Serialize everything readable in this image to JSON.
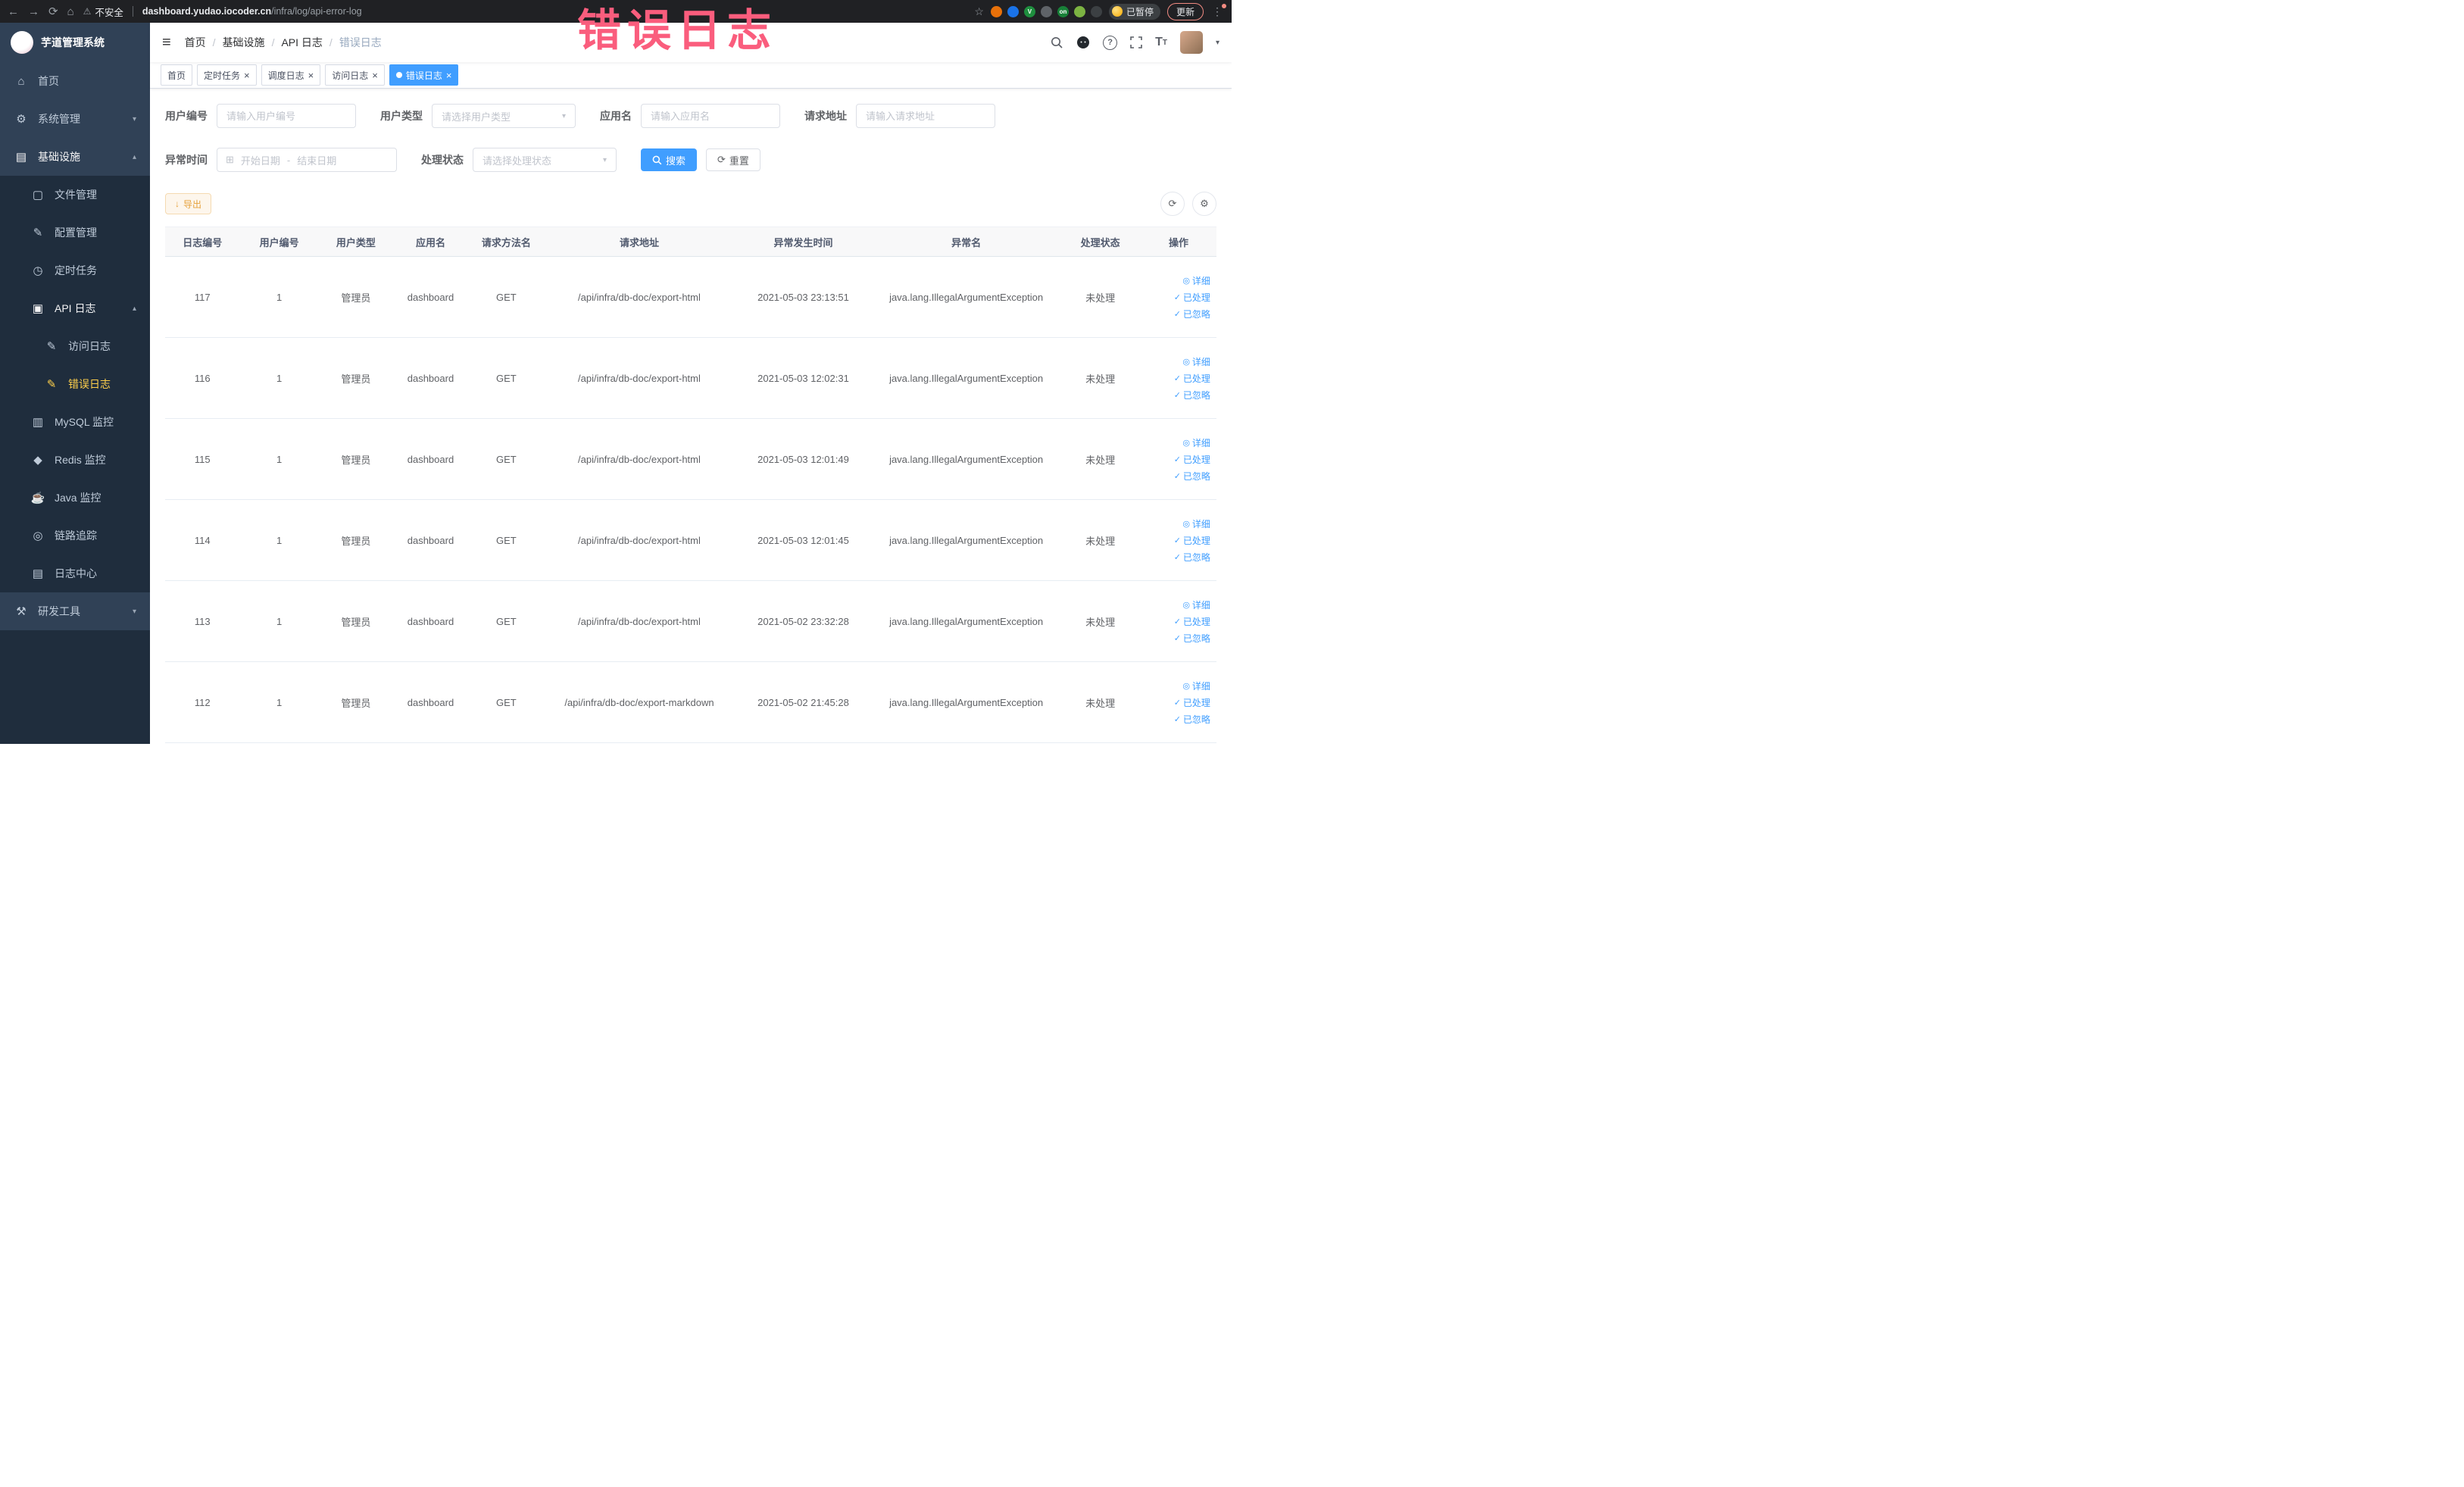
{
  "colors": {
    "accent": "#409eff",
    "warning": "#e6a23c",
    "sidebar_bg": "#304156",
    "submenu_bg": "#1f2d3d",
    "sidebar_text": "#bfcbd9",
    "active_menu_text": "#ffd04b",
    "overlay_text": "#fa5d7d",
    "chrome_bg": "#202124",
    "tag_active_bg": "#409eff",
    "table_header_bg": "#f8f8f9"
  },
  "icons": {
    "back": "←",
    "forward": "→",
    "reload": "⟳",
    "home-nav": "⌂",
    "warning": "⚠",
    "star": "☆",
    "more": "⋮",
    "menu": "≡",
    "caret": "▾",
    "question": "?",
    "font": "T",
    "home": "⌂",
    "system": "⚙",
    "infra": "▤",
    "file": "▢",
    "config": "✎",
    "job": "◷",
    "api-log": "▣",
    "doc": "✎",
    "mysql": "▥",
    "redis": "◆",
    "java": "☕",
    "trace": "◎",
    "log-center": "▤",
    "dev-tools": "⚒",
    "chevron-down": "▾",
    "chevron-up": "▴",
    "calendar": "⊞",
    "refresh": "⟳",
    "settings": "⚙",
    "download": "↓",
    "close": "×",
    "eye": "◎",
    "check": "✓"
  },
  "browser": {
    "security_label": "不安全",
    "url_domain": "dashboard.yudao.iocoder.cn",
    "url_path": "/infra/log/api-error-log",
    "profile_badge": "已暂停",
    "update_label": "更新",
    "extensions": [
      {
        "name": "extension-orange-circle",
        "color": "#e8710a",
        "glyph": ""
      },
      {
        "name": "extension-blue-drop",
        "color": "#1a73e8",
        "glyph": ""
      },
      {
        "name": "extension-green-v",
        "color": "#1e8e3e",
        "glyph": "V"
      },
      {
        "name": "extension-color-grid",
        "color": "#5f6368",
        "glyph": ""
      },
      {
        "name": "extension-on-badge",
        "color": "#188038",
        "glyph": "on"
      },
      {
        "name": "extension-leaf",
        "color": "#7cb342",
        "glyph": ""
      },
      {
        "name": "extension-puzzle",
        "color": "#3c4043",
        "glyph": ""
      }
    ]
  },
  "overlay": {
    "text": "错误日志"
  },
  "sidebar": {
    "logo_title": "芋道管理系统",
    "items": [
      {
        "key": "home",
        "label": "首页",
        "icon": "home",
        "level": 0
      },
      {
        "key": "system",
        "label": "系统管理",
        "icon": "system",
        "level": 0,
        "expandable": true,
        "expanded": false
      },
      {
        "key": "infra",
        "label": "基础设施",
        "icon": "infra",
        "level": 0,
        "expandable": true,
        "expanded": true,
        "emph": true
      },
      {
        "key": "file",
        "label": "文件管理",
        "icon": "file",
        "level": 1
      },
      {
        "key": "config",
        "label": "配置管理",
        "icon": "config",
        "level": 1
      },
      {
        "key": "job",
        "label": "定时任务",
        "icon": "job",
        "level": 1
      },
      {
        "key": "api-log",
        "label": "API 日志",
        "icon": "api-log",
        "level": 1,
        "expandable": true,
        "expanded": true,
        "emph": true
      },
      {
        "key": "access-log",
        "label": "访问日志",
        "icon": "doc",
        "level": 2
      },
      {
        "key": "error-log",
        "label": "错误日志",
        "icon": "doc",
        "level": 2,
        "active": true
      },
      {
        "key": "mysql",
        "label": "MySQL 监控",
        "icon": "mysql",
        "level": 1
      },
      {
        "key": "redis",
        "label": "Redis 监控",
        "icon": "redis",
        "level": 1
      },
      {
        "key": "java",
        "label": "Java 监控",
        "icon": "java",
        "level": 1
      },
      {
        "key": "trace",
        "label": "链路追踪",
        "icon": "trace",
        "level": 1
      },
      {
        "key": "log-center",
        "label": "日志中心",
        "icon": "log-center",
        "level": 1
      },
      {
        "key": "dev-tools",
        "label": "研发工具",
        "icon": "dev-tools",
        "level": 0,
        "expandable": true,
        "expanded": false
      }
    ]
  },
  "topbar": {
    "breadcrumb": [
      "首页",
      "基础设施",
      "API 日志",
      "错误日志"
    ]
  },
  "tags": [
    {
      "key": "home",
      "label": "首页",
      "closable": false,
      "active": false
    },
    {
      "key": "job",
      "label": "定时任务",
      "closable": true,
      "active": false
    },
    {
      "key": "job-log",
      "label": "调度日志",
      "closable": true,
      "active": false
    },
    {
      "key": "access-log",
      "label": "访问日志",
      "closable": true,
      "active": false
    },
    {
      "key": "error-log",
      "label": "错误日志",
      "closable": true,
      "active": true
    }
  ],
  "filters": {
    "user_id": {
      "label": "用户编号",
      "placeholder": "请输入用户编号"
    },
    "user_type": {
      "label": "用户类型",
      "placeholder": "请选择用户类型"
    },
    "app_name": {
      "label": "应用名",
      "placeholder": "请输入应用名"
    },
    "request_url": {
      "label": "请求地址",
      "placeholder": "请输入请求地址"
    },
    "exception_time": {
      "label": "异常时间",
      "start_placeholder": "开始日期",
      "separator": "-",
      "end_placeholder": "结束日期"
    },
    "process_status": {
      "label": "处理状态",
      "placeholder": "请选择处理状态"
    },
    "search_label": "搜索",
    "reset_label": "重置"
  },
  "toolbar": {
    "export_label": "导出"
  },
  "table": {
    "columns": [
      "日志编号",
      "用户编号",
      "用户类型",
      "应用名",
      "请求方法名",
      "请求地址",
      "异常发生时间",
      "异常名",
      "处理状态",
      "操作"
    ],
    "row_actions": [
      {
        "key": "detail",
        "label": "详细",
        "icon": "eye"
      },
      {
        "key": "processed",
        "label": "已处理",
        "icon": "check"
      },
      {
        "key": "ignored",
        "label": "已忽略",
        "icon": "check"
      }
    ],
    "rows": [
      {
        "id": "117",
        "user_id": "1",
        "user_type": "管理员",
        "app": "dashboard",
        "method": "GET",
        "url": "/api/infra/db-doc/export-html",
        "time": "2021-05-03 23:13:51",
        "exception": "java.lang.IllegalArgumentException",
        "status": "未处理"
      },
      {
        "id": "116",
        "user_id": "1",
        "user_type": "管理员",
        "app": "dashboard",
        "method": "GET",
        "url": "/api/infra/db-doc/export-html",
        "time": "2021-05-03 12:02:31",
        "exception": "java.lang.IllegalArgumentException",
        "status": "未处理"
      },
      {
        "id": "115",
        "user_id": "1",
        "user_type": "管理员",
        "app": "dashboard",
        "method": "GET",
        "url": "/api/infra/db-doc/export-html",
        "time": "2021-05-03 12:01:49",
        "exception": "java.lang.IllegalArgumentException",
        "status": "未处理"
      },
      {
        "id": "114",
        "user_id": "1",
        "user_type": "管理员",
        "app": "dashboard",
        "method": "GET",
        "url": "/api/infra/db-doc/export-html",
        "time": "2021-05-03 12:01:45",
        "exception": "java.lang.IllegalArgumentException",
        "status": "未处理"
      },
      {
        "id": "113",
        "user_id": "1",
        "user_type": "管理员",
        "app": "dashboard",
        "method": "GET",
        "url": "/api/infra/db-doc/export-html",
        "time": "2021-05-02 23:32:28",
        "exception": "java.lang.IllegalArgumentException",
        "status": "未处理"
      },
      {
        "id": "112",
        "user_id": "1",
        "user_type": "管理员",
        "app": "dashboard",
        "method": "GET",
        "url": "/api/infra/db-doc/export-markdown",
        "time": "2021-05-02 21:45:28",
        "exception": "java.lang.IllegalArgumentException",
        "status": "未处理"
      }
    ]
  }
}
